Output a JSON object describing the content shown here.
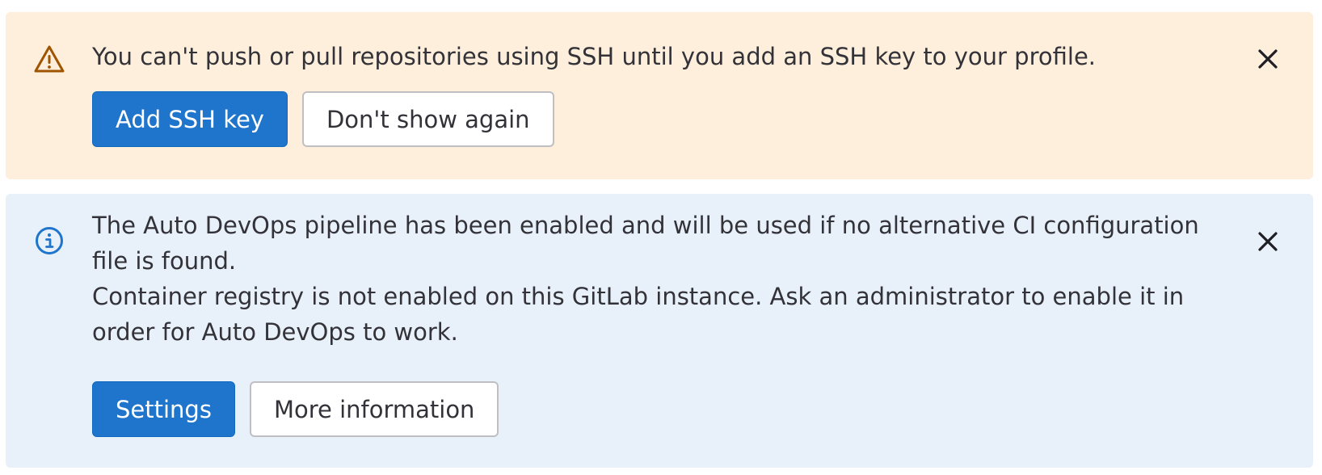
{
  "ssh_alert": {
    "variant": "warning",
    "icon": "warning-icon",
    "message": "You can't push or pull repositories using SSH until you add an SSH key to your profile.",
    "primary_label": "Add SSH key",
    "secondary_label": "Don't show again",
    "close_icon": "close-icon",
    "background": "#fdefdc",
    "icon_color": "#9e5400"
  },
  "devops_alert": {
    "variant": "info",
    "icon": "info-icon",
    "message_1": "The Auto DevOps pipeline has been enabled and will be used if no alternative CI configuration file is found.",
    "message_2": "Container registry is not enabled on this GitLab instance. Ask an administrator to enable it in order for Auto DevOps to work.",
    "primary_label": "Settings",
    "secondary_label": "More information",
    "close_icon": "close-icon",
    "background": "#e8f1fa",
    "icon_color": "#1f75cb"
  },
  "colors": {
    "primary_button": "#1f75cb",
    "text": "#333238",
    "button_border": "#bfbfc3"
  }
}
